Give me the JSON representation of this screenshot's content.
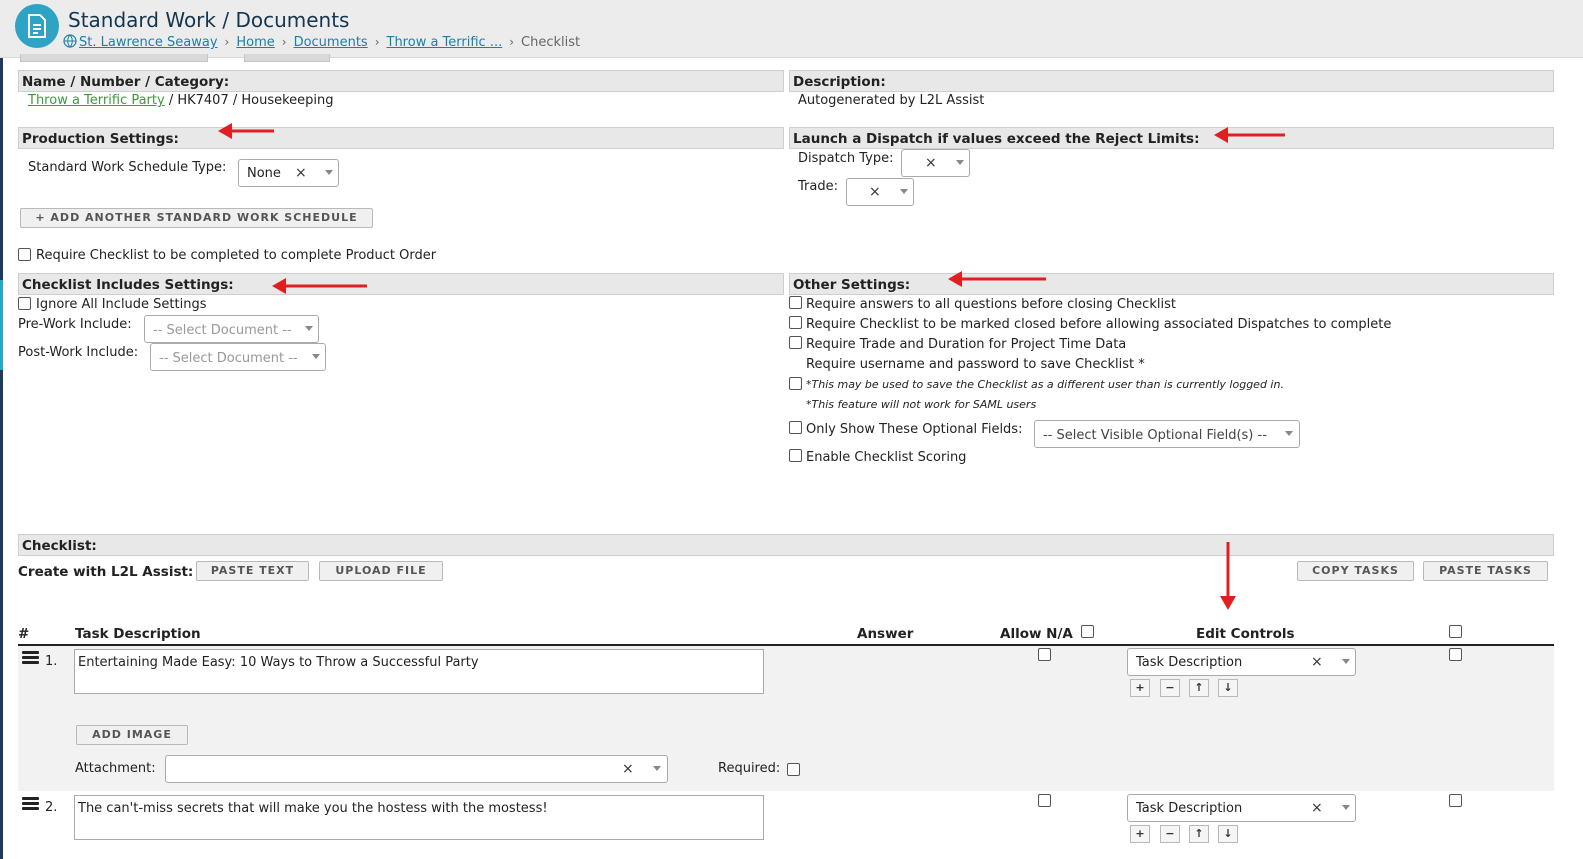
{
  "header": {
    "title": "Standard Work / Documents",
    "breadcrumbs": {
      "site": "St. Lawrence Seaway",
      "home": "Home",
      "documents": "Documents",
      "document": "Throw a Terrific ...",
      "current": "Checklist"
    }
  },
  "info": {
    "name_label": "Name / Number / Category:",
    "name_link": "Throw a Terrific Party",
    "number_category": " / HK7407 / Housekeeping",
    "description_label": "Description:",
    "description_value": "Autogenerated by L2L Assist"
  },
  "production": {
    "label": "Production Settings:",
    "schedule_type_label": "Standard Work Schedule Type:",
    "schedule_type_value": "None",
    "add_schedule_button": "+ ADD ANOTHER STANDARD WORK SCHEDULE",
    "require_checklist_label": "Require Checklist to be completed to complete Product Order"
  },
  "dispatch": {
    "label": "Launch a Dispatch if values exceed the Reject Limits:",
    "dispatch_type_label": "Dispatch Type:",
    "trade_label": "Trade:"
  },
  "includes": {
    "label": "Checklist Includes Settings:",
    "ignore_label": "Ignore All Include Settings",
    "prework_label": "Pre-Work Include:",
    "prework_placeholder": "-- Select Document --",
    "postwork_label": "Post-Work Include:",
    "postwork_placeholder": "-- Select Document --"
  },
  "other": {
    "label": "Other Settings:",
    "require_answers": "Require answers to all questions before closing Checklist",
    "require_closed": "Require Checklist to be marked closed before allowing associated Dispatches to complete",
    "require_trade": "Require Trade and Duration for Project Time Data",
    "require_username": "Require username and password to save Checklist *",
    "note1": "*This may be used to save the Checklist as a different user than is currently logged in.",
    "note2": "*This feature will not work for SAML users",
    "optional_fields_label": "Only Show These Optional Fields:",
    "optional_fields_placeholder": "-- Select Visible Optional Field(s) --",
    "scoring_label": "Enable Checklist Scoring"
  },
  "checklist": {
    "label": "Checklist:",
    "create_label": "Create with L2L Assist:",
    "paste_text": "PASTE TEXT",
    "upload_file": "UPLOAD FILE",
    "copy_tasks": "COPY TASKS",
    "paste_tasks": "PASTE TASKS",
    "columns": {
      "num": "#",
      "task": "Task Description",
      "answer": "Answer",
      "allow_na": "Allow N/A",
      "edit": "Edit Controls"
    },
    "tasks": [
      {
        "num": "1.",
        "text": "Entertaining Made Easy: 10 Ways to Throw a Successful Party",
        "control": "Task Description",
        "add_image": "ADD IMAGE",
        "attachment_label": "Attachment:",
        "required_label": "Required:"
      },
      {
        "num": "2.",
        "text": "The can't-miss secrets that will make you the hostess with the mostess!",
        "control": "Task Description"
      }
    ]
  },
  "colors": {
    "accent": "#2ea3c4",
    "title": "#14364f",
    "link": "#1d7fa5",
    "annotation_arrow": "#e02020"
  }
}
